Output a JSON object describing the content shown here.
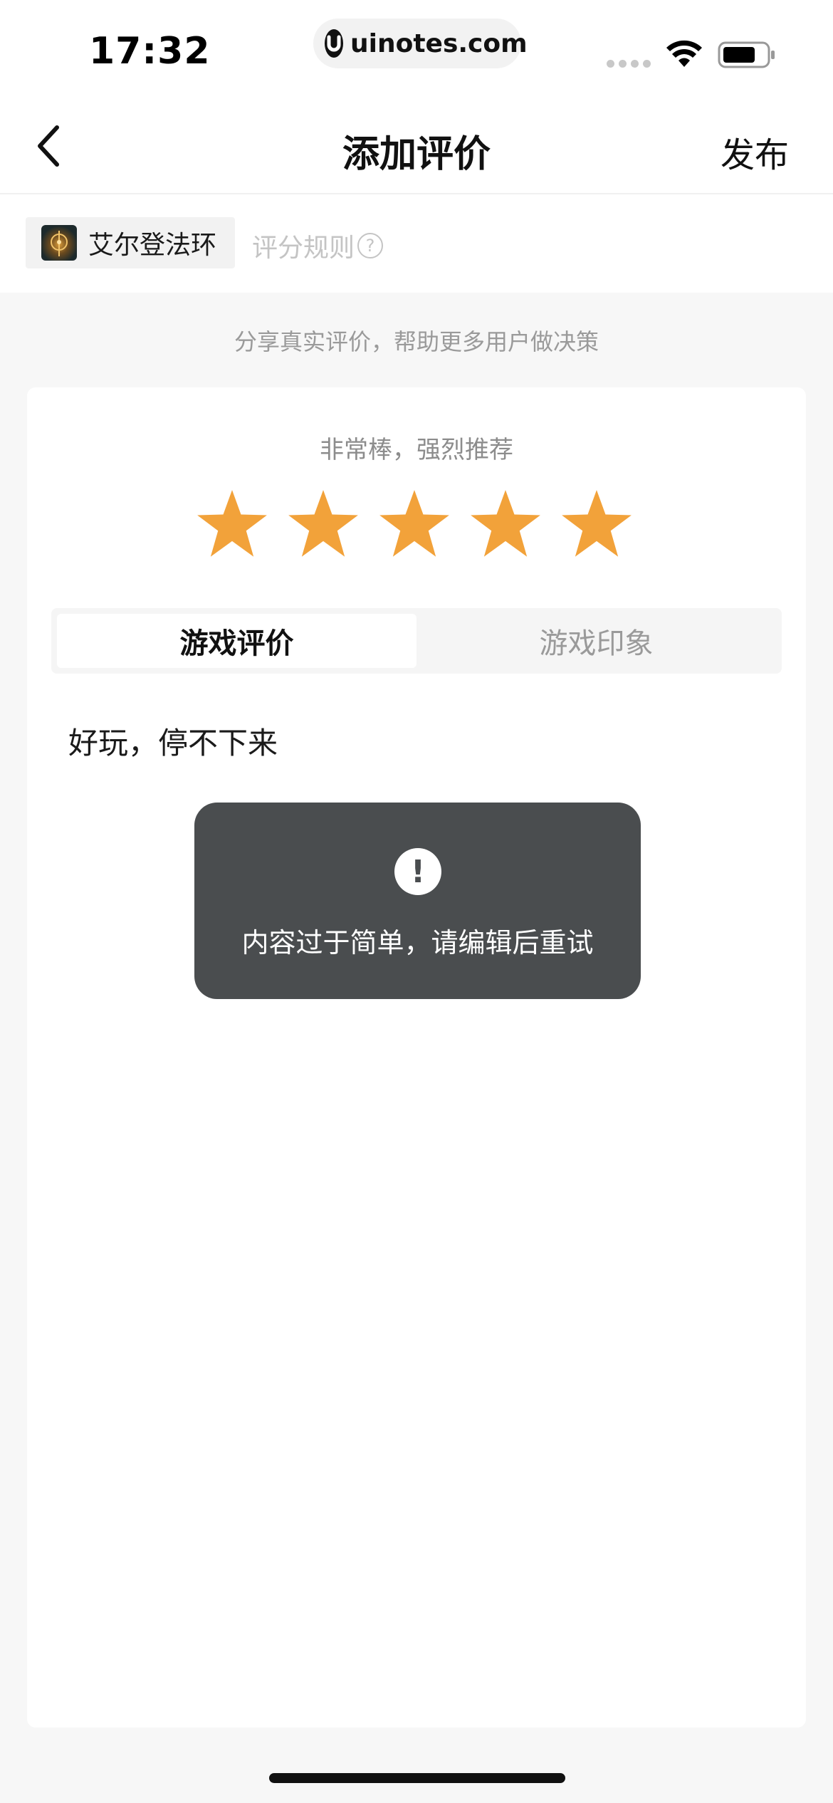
{
  "status_bar": {
    "time": "17:32",
    "url": "uinotes.com"
  },
  "nav": {
    "back_icon": "chevron-left-icon",
    "title": "添加评价",
    "publish_label": "发布"
  },
  "game": {
    "name": "艾尔登法环",
    "rules_label": "评分规则",
    "help_icon": "?"
  },
  "share_tip": "分享真实评价，帮助更多用户做决策",
  "rating": {
    "text": "非常棒，强烈推荐",
    "stars": 5,
    "max_stars": 5,
    "star_color": "#f2a23a"
  },
  "tabs": [
    {
      "label": "游戏评价",
      "active": true
    },
    {
      "label": "游戏印象",
      "active": false
    }
  ],
  "review": {
    "text": "好玩，停不下来"
  },
  "toast": {
    "icon": "!",
    "message": "内容过于简单，请编辑后重试"
  }
}
